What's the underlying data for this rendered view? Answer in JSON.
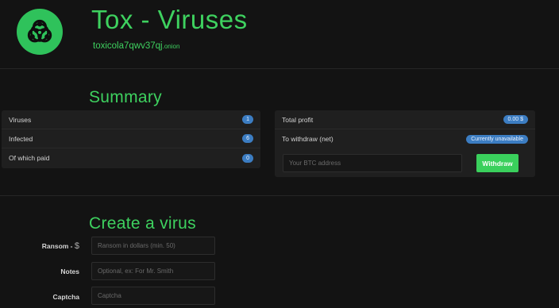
{
  "header": {
    "title": "Tox - Viruses",
    "onion_name": "toxicola7qwv37qj",
    "onion_tld": ".onion",
    "logo_icon": "biohazard-icon"
  },
  "summary": {
    "title": "Summary",
    "rows": [
      {
        "label": "Viruses",
        "value": "1"
      },
      {
        "label": "Infected",
        "value": "6"
      },
      {
        "label": "Of which paid",
        "value": "0"
      }
    ],
    "profit": {
      "total_label": "Total profit",
      "total_value": "0.00 $",
      "withdraw_label": "To withdraw (net)",
      "withdraw_value": "Currently unavailable",
      "btc_placeholder": "Your BTC address",
      "withdraw_button": "Withdraw"
    }
  },
  "create": {
    "title": "Create a virus",
    "ransom_label": "Ransom - ",
    "ransom_symbol": "$",
    "ransom_placeholder": "Ransom in dollars (min. 50)",
    "notes_label": "Notes",
    "notes_placeholder": "Optional, ex: For Mr. Smith",
    "captcha_label": "Captcha",
    "captcha_placeholder": "Captcha"
  },
  "colors": {
    "accent_green": "#3ed15f",
    "badge_blue": "#3c7dc2",
    "background": "#131313",
    "panel": "#1f1f1f"
  }
}
